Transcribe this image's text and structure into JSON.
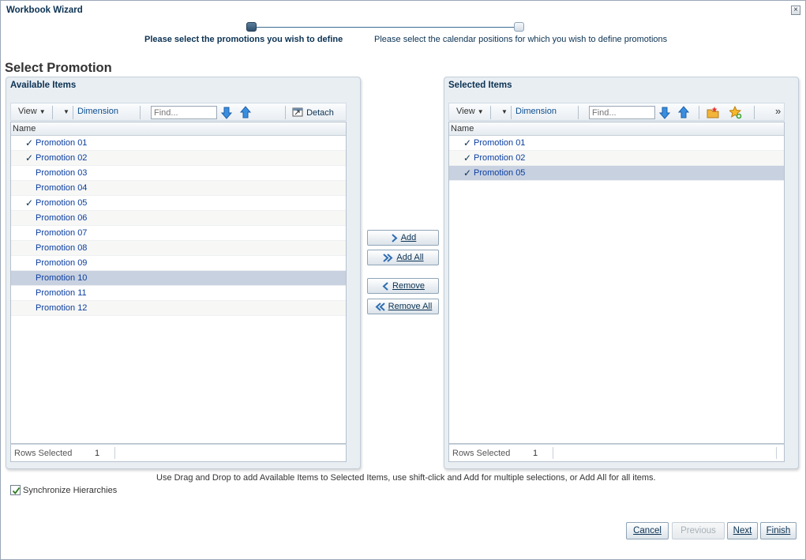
{
  "window": {
    "title": "Workbook Wizard",
    "close_glyph": "×"
  },
  "train": {
    "steps": [
      {
        "label": "Please select the promotions you wish to define",
        "state": "active"
      },
      {
        "label": "Please select the calendar positions for which you wish to define promotions",
        "state": "inactive"
      }
    ]
  },
  "heading": "Select Promotion",
  "available": {
    "title": "Available Items",
    "toolbar": {
      "view": "View",
      "dimension": "Dimension",
      "find_placeholder": "Find...",
      "detach": "Detach"
    },
    "column": "Name",
    "rows": [
      {
        "label": "Promotion 01",
        "checked": true,
        "selected": false
      },
      {
        "label": "Promotion 02",
        "checked": true,
        "selected": false
      },
      {
        "label": "Promotion 03",
        "checked": false,
        "selected": false
      },
      {
        "label": "Promotion 04",
        "checked": false,
        "selected": false
      },
      {
        "label": "Promotion 05",
        "checked": true,
        "selected": false
      },
      {
        "label": "Promotion 06",
        "checked": false,
        "selected": false
      },
      {
        "label": "Promotion 07",
        "checked": false,
        "selected": false
      },
      {
        "label": "Promotion 08",
        "checked": false,
        "selected": false
      },
      {
        "label": "Promotion 09",
        "checked": false,
        "selected": false
      },
      {
        "label": "Promotion 10",
        "checked": false,
        "selected": true
      },
      {
        "label": "Promotion 11",
        "checked": false,
        "selected": false
      },
      {
        "label": "Promotion 12",
        "checked": false,
        "selected": false
      }
    ],
    "status_label": "Rows Selected",
    "status_count": "1"
  },
  "selected": {
    "title": "Selected Items",
    "toolbar": {
      "view": "View",
      "dimension": "Dimension",
      "find_placeholder": "Find...",
      "overflow": "»"
    },
    "column": "Name",
    "rows": [
      {
        "label": "Promotion 01",
        "checked": true,
        "selected": false
      },
      {
        "label": "Promotion 02",
        "checked": true,
        "selected": false
      },
      {
        "label": "Promotion 05",
        "checked": true,
        "selected": true
      }
    ],
    "status_label": "Rows Selected",
    "status_count": "1"
  },
  "shuttle": {
    "add": "Add",
    "add_all": "Add All",
    "remove": "Remove",
    "remove_all": "Remove All"
  },
  "hint": "Use Drag and Drop to add Available Items to Selected Items, use shift-click and Add for multiple selections, or Add All for all items.",
  "sync": {
    "label": "Synchronize Hierarchies",
    "checked": true
  },
  "footer": {
    "cancel": "Cancel",
    "previous": "Previous",
    "next": "Next",
    "finish": "Finish"
  },
  "colors": {
    "title_text": "#0b3253",
    "link": "#0b3ea1",
    "selected_row": "#c8d1e0",
    "arrow_blue": "#2f7fd6"
  }
}
